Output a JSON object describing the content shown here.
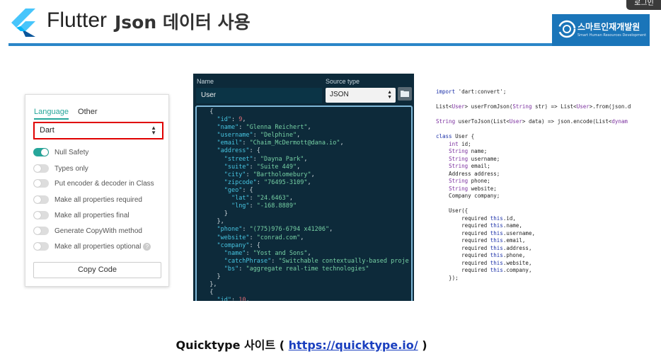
{
  "header": {
    "logo_word": "Flutter",
    "title": "Json 데이터 사용",
    "brand_name": "스마트인재개발원",
    "brand_sub": "Smart Human Resources Development",
    "login": "로그인"
  },
  "settings": {
    "tabs": [
      {
        "label": "Language",
        "active": true
      },
      {
        "label": "Other",
        "active": false
      }
    ],
    "language_value": "Dart",
    "options": [
      {
        "label": "Null Safety",
        "on": true
      },
      {
        "label": "Types only",
        "on": false
      },
      {
        "label": "Put encoder & decoder in Class",
        "on": false
      },
      {
        "label": "Make all properties required",
        "on": false
      },
      {
        "label": "Make all properties final",
        "on": false
      },
      {
        "label": "Generate CopyWith method",
        "on": false
      },
      {
        "label": "Make all properties optional",
        "on": false
      }
    ],
    "copy_button": "Copy Code"
  },
  "editor": {
    "name_label": "Name",
    "source_type_label": "Source type",
    "name_value": "User",
    "source_type_value": "JSON",
    "code": [
      "  {",
      "    \"id\": 9,",
      "    \"name\": \"Glenna Reichert\",",
      "    \"username\": \"Delphine\",",
      "    \"email\": \"Chaim_McDermott@dana.io\",",
      "    \"address\": {",
      "      \"street\": \"Dayna Park\",",
      "      \"suite\": \"Suite 449\",",
      "      \"city\": \"Bartholomebury\",",
      "      \"zipcode\": \"76495-3109\",",
      "      \"geo\": {",
      "        \"lat\": \"24.6463\",",
      "        \"lng\": \"-168.8889\"",
      "      }",
      "    },",
      "    \"phone\": \"(775)976-6794 x41206\",",
      "    \"website\": \"conrad.com\",",
      "    \"company\": {",
      "      \"name\": \"Yost and Sons\",",
      "      \"catchPhrase\": \"Switchable contextually-based proje",
      "      \"bs\": \"aggregate real-time technologies\"",
      "    }",
      "  },",
      "  {",
      "    \"id\": 10,"
    ]
  },
  "dart": {
    "lines": [
      "import 'dart:convert';",
      "",
      "List<User> userFromJson(String str) => List<User>.from(json.d",
      "",
      "String userToJson(List<User> data) => json.encode(List<dynam",
      "",
      "class User {",
      "    int id;",
      "    String name;",
      "    String username;",
      "    String email;",
      "    Address address;",
      "    String phone;",
      "    String website;",
      "    Company company;",
      "",
      "    User({",
      "        required this.id,",
      "        required this.name,",
      "        required this.username,",
      "        required this.email,",
      "        required this.address,",
      "        required this.phone,",
      "        required this.website,",
      "        required this.company,",
      "    });"
    ]
  },
  "caption": {
    "text": "Quicktype 사이트 ( ",
    "link": "https://quicktype.io/",
    "close": " )"
  }
}
